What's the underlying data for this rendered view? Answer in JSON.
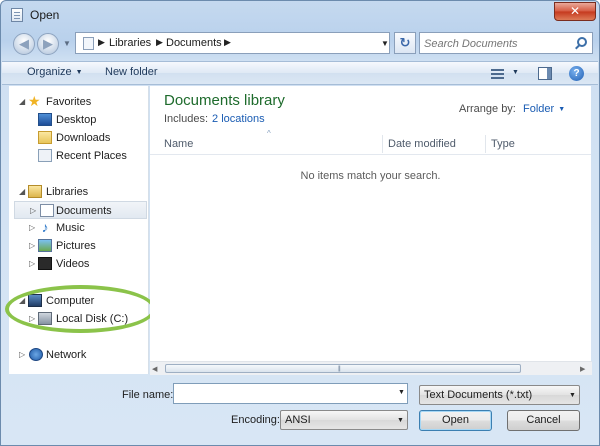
{
  "window": {
    "title": "Open",
    "close_glyph": "✕"
  },
  "address": {
    "back_glyph": "◀",
    "forward_glyph": "▶",
    "recent_glyph": "▼",
    "crumb_sep": "▶",
    "crumbs": [
      "Libraries",
      "Documents"
    ],
    "dropdown_glyph": "▼",
    "refresh_glyph": "↻"
  },
  "search": {
    "placeholder": "Search Documents"
  },
  "toolbar": {
    "organize_label": "Organize",
    "caret": "▼",
    "new_folder_label": "New folder",
    "help_glyph": "?"
  },
  "navpane": {
    "expanded_glyph": "◢",
    "collapsed_glyph": "▷",
    "favorites": "Favorites",
    "desktop": "Desktop",
    "downloads": "Downloads",
    "recent_places": "Recent Places",
    "libraries": "Libraries",
    "documents": "Documents",
    "music": "Music",
    "pictures": "Pictures",
    "videos": "Videos",
    "computer": "Computer",
    "local_disk": "Local Disk (C:)",
    "network": "Network",
    "star_glyph": "★",
    "note_glyph": "♪"
  },
  "content": {
    "library_title": "Documents library",
    "includes_label": "Includes:",
    "locations_link": "2 locations",
    "arrange_label": "Arrange by:",
    "arrange_value": "Folder",
    "columns": [
      "Name",
      "Date modified",
      "Type"
    ],
    "sort_glyph": "^",
    "empty_message": "No items match your search."
  },
  "scroll": {
    "left_glyph": "◀",
    "right_glyph": "▶",
    "grip": "|||"
  },
  "bottom": {
    "filename_label": "File name:",
    "filename_value": "",
    "filetype_value": "Text Documents (*.txt)",
    "encoding_label": "Encoding:",
    "encoding_value": "ANSI",
    "open_label": "Open",
    "cancel_label": "Cancel"
  },
  "colors": {
    "annotation_circle": "#8bc34a",
    "library_title": "#1e6b2c",
    "link": "#1a5cb3"
  }
}
